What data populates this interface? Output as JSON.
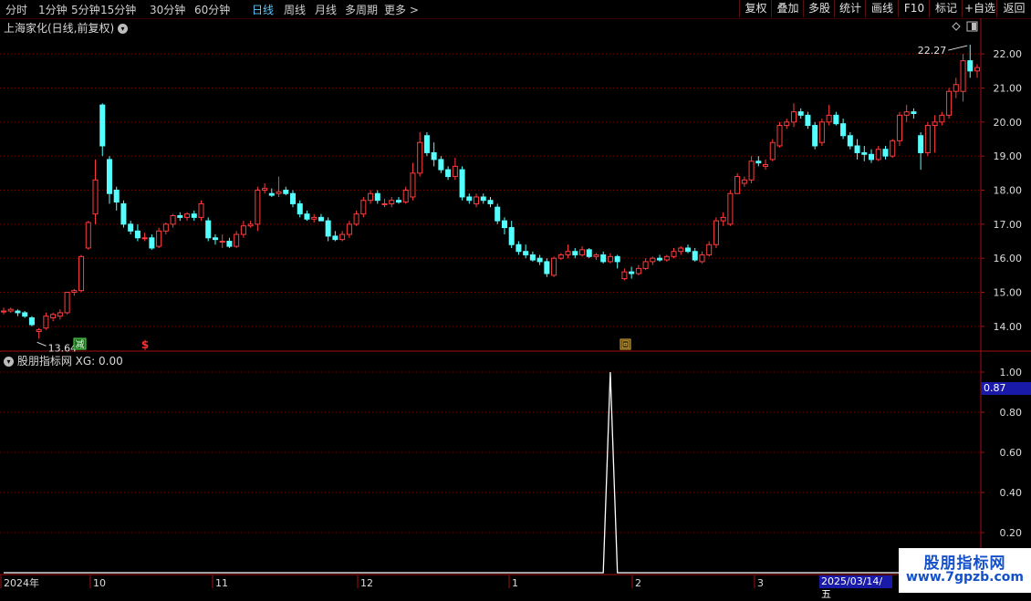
{
  "toolbar": {
    "periods": [
      "分时",
      "1分钟",
      "5分钟",
      "15分钟",
      "30分钟",
      "60分钟",
      "日线",
      "周线",
      "月线",
      "多周期",
      "更多 >"
    ],
    "active_period": "日线",
    "right_buttons": [
      "复权",
      "叠加",
      "多股",
      "统计",
      "画线",
      "F10",
      "标记",
      "+自选",
      "返回"
    ]
  },
  "main_panel": {
    "title": "上海家化(日线,前复权)",
    "high_label": "22.27",
    "low_label": "13.64",
    "signal_labels": [
      "减",
      "$",
      "回"
    ],
    "y_ticks": [
      "22.00",
      "21.00",
      "20.00",
      "19.00",
      "18.00",
      "17.00",
      "16.00",
      "15.00",
      "14.00"
    ]
  },
  "sub_panel": {
    "title": "股朋指标网 XG: 0.00",
    "y_ticks": [
      "1.00",
      "0.80",
      "0.60",
      "0.40",
      "0.20"
    ],
    "value_tag": "0.87"
  },
  "x_axis": {
    "labels": [
      "2024年",
      "10",
      "11",
      "12",
      "1",
      "2",
      "3"
    ],
    "active_label": "2025/03/14/五"
  },
  "watermark": {
    "title": "股朋指标网",
    "url": "www.7gpzb.com"
  },
  "colors": {
    "up": "#ff3c3c",
    "down": "#54ffff",
    "grid": "#7a0000",
    "frame": "#a01010",
    "axis_text": "#dcdcdc"
  },
  "chart_data": [
    {
      "type": "candlestick",
      "title": "上海家化(日线,前复权)",
      "ylim": [
        13.3,
        22.7
      ],
      "max_marker": 22.27,
      "min_marker": 13.64,
      "candles_ohlc": [
        [
          14.45,
          14.55,
          14.35,
          14.45
        ],
        [
          14.45,
          14.55,
          14.4,
          14.5
        ],
        [
          14.45,
          14.5,
          14.3,
          14.4
        ],
        [
          14.4,
          14.45,
          14.25,
          14.3
        ],
        [
          14.25,
          14.3,
          14.0,
          14.05
        ],
        [
          13.85,
          13.95,
          13.64,
          13.9
        ],
        [
          13.95,
          14.4,
          13.9,
          14.3
        ],
        [
          14.25,
          14.4,
          14.15,
          14.35
        ],
        [
          14.3,
          14.5,
          14.2,
          14.4
        ],
        [
          14.4,
          15.0,
          14.35,
          15.0
        ],
        [
          15.0,
          15.1,
          14.9,
          15.05
        ],
        [
          15.05,
          16.1,
          15.0,
          16.05
        ],
        [
          16.3,
          17.1,
          16.25,
          17.05
        ],
        [
          17.3,
          18.9,
          17.0,
          18.3
        ],
        [
          20.5,
          20.55,
          19.0,
          19.3
        ],
        [
          18.9,
          19.0,
          17.6,
          17.9
        ],
        [
          18.0,
          18.1,
          17.4,
          17.65
        ],
        [
          17.6,
          17.7,
          16.9,
          17.0
        ],
        [
          17.0,
          17.1,
          16.7,
          16.8
        ],
        [
          16.8,
          17.0,
          16.5,
          16.6
        ],
        [
          16.6,
          16.75,
          16.5,
          16.6
        ],
        [
          16.6,
          16.7,
          16.25,
          16.3
        ],
        [
          16.35,
          16.9,
          16.3,
          16.8
        ],
        [
          16.8,
          17.05,
          16.7,
          17.0
        ],
        [
          17.0,
          17.3,
          16.9,
          17.25
        ],
        [
          17.25,
          17.35,
          17.1,
          17.2
        ],
        [
          17.2,
          17.35,
          17.1,
          17.3
        ],
        [
          17.3,
          17.4,
          17.1,
          17.2
        ],
        [
          17.2,
          17.7,
          17.1,
          17.6
        ],
        [
          17.1,
          17.2,
          16.5,
          16.6
        ],
        [
          16.6,
          16.7,
          16.4,
          16.55
        ],
        [
          16.5,
          16.7,
          16.3,
          16.5
        ],
        [
          16.5,
          16.6,
          16.3,
          16.35
        ],
        [
          16.35,
          16.8,
          16.3,
          16.7
        ],
        [
          16.7,
          17.1,
          16.6,
          16.95
        ],
        [
          16.95,
          17.1,
          16.9,
          17.0
        ],
        [
          17.0,
          18.1,
          16.8,
          18.0
        ],
        [
          18.0,
          18.2,
          17.9,
          18.05
        ],
        [
          17.9,
          18.05,
          17.8,
          17.85
        ],
        [
          17.9,
          18.4,
          17.8,
          17.95
        ],
        [
          18.0,
          18.1,
          17.85,
          17.9
        ],
        [
          17.9,
          18.0,
          17.5,
          17.6
        ],
        [
          17.6,
          17.7,
          17.2,
          17.3
        ],
        [
          17.3,
          17.4,
          17.1,
          17.15
        ],
        [
          17.15,
          17.3,
          17.05,
          17.2
        ],
        [
          17.2,
          17.3,
          17.1,
          17.1
        ],
        [
          17.1,
          17.2,
          16.5,
          16.65
        ],
        [
          16.65,
          16.8,
          16.5,
          16.55
        ],
        [
          16.55,
          16.8,
          16.5,
          16.7
        ],
        [
          16.7,
          17.1,
          16.6,
          17.0
        ],
        [
          17.0,
          17.4,
          16.95,
          17.3
        ],
        [
          17.3,
          17.8,
          17.2,
          17.7
        ],
        [
          17.7,
          18.0,
          17.6,
          17.9
        ],
        [
          17.9,
          18.0,
          17.6,
          17.7
        ],
        [
          17.6,
          17.75,
          17.5,
          17.6
        ],
        [
          17.6,
          17.8,
          17.5,
          17.7
        ],
        [
          17.7,
          17.8,
          17.6,
          17.65
        ],
        [
          17.65,
          18.1,
          17.6,
          18.0
        ],
        [
          17.8,
          18.8,
          17.7,
          18.5
        ],
        [
          18.5,
          19.7,
          18.4,
          19.4
        ],
        [
          19.6,
          19.7,
          19.0,
          19.1
        ],
        [
          19.1,
          19.4,
          18.7,
          18.9
        ],
        [
          18.9,
          19.0,
          18.5,
          18.6
        ],
        [
          18.6,
          18.7,
          18.3,
          18.4
        ],
        [
          18.4,
          18.95,
          18.3,
          18.7
        ],
        [
          18.6,
          18.7,
          17.7,
          17.8
        ],
        [
          17.8,
          17.9,
          17.6,
          17.7
        ],
        [
          17.6,
          17.9,
          17.5,
          17.8
        ],
        [
          17.8,
          17.9,
          17.6,
          17.7
        ],
        [
          17.7,
          17.8,
          17.5,
          17.6
        ],
        [
          17.5,
          17.6,
          17.0,
          17.1
        ],
        [
          17.1,
          17.2,
          16.7,
          16.9
        ],
        [
          16.9,
          17.1,
          16.3,
          16.4
        ],
        [
          16.4,
          16.5,
          16.1,
          16.2
        ],
        [
          16.2,
          16.4,
          16.0,
          16.1
        ],
        [
          16.1,
          16.2,
          15.9,
          15.95
        ],
        [
          16.0,
          16.1,
          15.8,
          15.9
        ],
        [
          15.9,
          16.0,
          15.45,
          15.55
        ],
        [
          15.5,
          16.05,
          15.45,
          16.0
        ],
        [
          16.0,
          16.15,
          15.95,
          16.1
        ],
        [
          16.1,
          16.4,
          16.0,
          16.2
        ],
        [
          16.2,
          16.3,
          16.0,
          16.1
        ],
        [
          16.1,
          16.35,
          16.05,
          16.25
        ],
        [
          16.25,
          16.3,
          16.0,
          16.05
        ],
        [
          16.05,
          16.15,
          15.95,
          16.1
        ],
        [
          16.1,
          16.2,
          15.85,
          15.9
        ],
        [
          15.9,
          16.15,
          15.85,
          16.05
        ],
        [
          16.05,
          16.1,
          15.7,
          15.9
        ],
        [
          15.4,
          15.7,
          15.35,
          15.6
        ],
        [
          15.6,
          15.75,
          15.4,
          15.55
        ],
        [
          15.55,
          15.8,
          15.5,
          15.7
        ],
        [
          15.7,
          16.0,
          15.65,
          15.9
        ],
        [
          15.9,
          16.05,
          15.8,
          16.0
        ],
        [
          16.0,
          16.1,
          15.9,
          15.95
        ],
        [
          15.95,
          16.1,
          15.9,
          16.05
        ],
        [
          16.05,
          16.3,
          16.0,
          16.2
        ],
        [
          16.2,
          16.35,
          16.1,
          16.3
        ],
        [
          16.3,
          16.4,
          16.15,
          16.2
        ],
        [
          16.2,
          16.3,
          15.9,
          15.95
        ],
        [
          15.9,
          16.2,
          15.85,
          16.1
        ],
        [
          16.1,
          16.5,
          16.05,
          16.4
        ],
        [
          16.4,
          17.2,
          16.3,
          17.1
        ],
        [
          17.1,
          17.35,
          16.95,
          17.2
        ],
        [
          17.0,
          18.0,
          16.95,
          17.9
        ],
        [
          17.9,
          18.5,
          17.9,
          18.4
        ],
        [
          18.2,
          18.4,
          18.1,
          18.3
        ],
        [
          18.3,
          19.0,
          18.2,
          18.85
        ],
        [
          18.85,
          19.0,
          18.7,
          18.8
        ],
        [
          18.7,
          18.9,
          18.6,
          18.75
        ],
        [
          18.9,
          19.5,
          18.85,
          19.4
        ],
        [
          19.3,
          20.0,
          19.25,
          19.9
        ],
        [
          19.9,
          20.1,
          19.8,
          20.0
        ],
        [
          20.0,
          20.55,
          19.85,
          20.3
        ],
        [
          20.3,
          20.4,
          20.1,
          20.2
        ],
        [
          20.2,
          20.3,
          19.8,
          19.9
        ],
        [
          19.9,
          20.0,
          19.2,
          19.3
        ],
        [
          19.4,
          20.1,
          19.3,
          20.0
        ],
        [
          20.0,
          20.5,
          19.9,
          20.2
        ],
        [
          20.2,
          20.3,
          19.9,
          19.95
        ],
        [
          19.95,
          20.1,
          19.5,
          19.6
        ],
        [
          19.6,
          19.7,
          19.2,
          19.3
        ],
        [
          19.3,
          19.5,
          18.9,
          19.1
        ],
        [
          19.1,
          19.3,
          18.85,
          19.05
        ],
        [
          19.05,
          19.2,
          18.8,
          18.9
        ],
        [
          18.9,
          19.3,
          18.85,
          19.2
        ],
        [
          19.2,
          19.3,
          18.9,
          19.0
        ],
        [
          19.0,
          19.5,
          18.95,
          19.45
        ],
        [
          19.45,
          20.3,
          19.3,
          20.2
        ],
        [
          20.2,
          20.5,
          20.0,
          20.3
        ],
        [
          20.3,
          20.4,
          20.1,
          20.25
        ],
        [
          19.6,
          19.7,
          18.6,
          19.1
        ],
        [
          19.1,
          20.0,
          19.0,
          19.9
        ],
        [
          19.9,
          20.2,
          19.1,
          20.0
        ],
        [
          20.0,
          20.3,
          19.9,
          20.2
        ],
        [
          20.2,
          21.0,
          20.1,
          20.9
        ],
        [
          20.9,
          21.3,
          20.7,
          21.1
        ],
        [
          20.9,
          22.0,
          20.6,
          21.8
        ],
        [
          21.8,
          22.27,
          21.3,
          21.5
        ],
        [
          21.5,
          21.7,
          21.3,
          21.6
        ]
      ]
    },
    {
      "type": "line",
      "title": "股朋指标网 XG: 0.00",
      "ylim": [
        0,
        1.1
      ],
      "series": [
        {
          "x": [
            0,
            85,
            86,
            87,
            140
          ],
          "values": [
            0,
            0,
            1.0,
            0,
            0
          ]
        }
      ]
    }
  ]
}
